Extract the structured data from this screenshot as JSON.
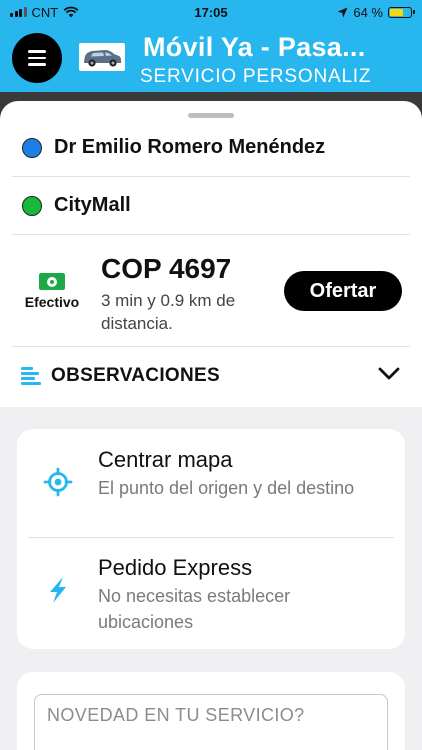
{
  "status_bar": {
    "carrier": "CNT",
    "time": "17:05",
    "battery": "64 %",
    "battery_level": 0.64
  },
  "header": {
    "title": "Móvil Ya - Pasa...",
    "subtitle": "SERVICIO PERSONALIZ"
  },
  "trip": {
    "origin": "Dr Emilio Romero Menéndez",
    "destination": "CityMall"
  },
  "fare": {
    "payment_label": "Efectivo",
    "amount": "COP 4697",
    "eta": "3 min y 0.9 km de distancia.",
    "offer_button": "Ofertar"
  },
  "observations": {
    "label": "OBSERVACIONES"
  },
  "actions": [
    {
      "title": "Centrar mapa",
      "description": "El punto del origen y del destino",
      "icon": "crosshair-icon"
    },
    {
      "title": "Pedido Express",
      "description": "No necesitas establecer ubicaciones",
      "icon": "lightning-icon"
    }
  ],
  "novelty": {
    "placeholder": "NOVEDAD EN TU SERVICIO?"
  },
  "colors": {
    "brand": "#27b6ee",
    "origin_dot": "#1e7ee8",
    "destination_dot": "#19b83a",
    "cash": "#1ea84a"
  }
}
